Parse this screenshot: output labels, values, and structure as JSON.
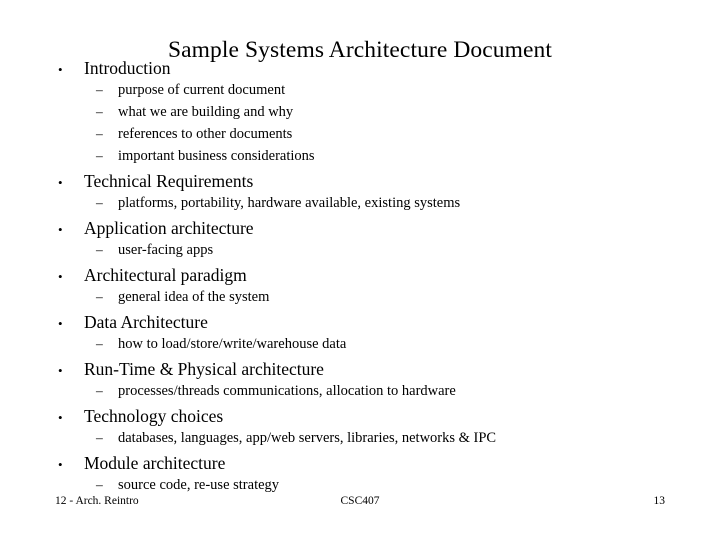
{
  "slide": {
    "title": "Sample Systems Architecture Document",
    "bullet_mark": "•",
    "sub_mark": "–",
    "sections": [
      {
        "heading": "Introduction",
        "items": [
          "purpose of current document",
          "what we are building and why",
          "references to other documents",
          "important business considerations"
        ]
      },
      {
        "heading": "Technical Requirements",
        "items": [
          "platforms, portability, hardware available, existing systems"
        ]
      },
      {
        "heading": "Application architecture",
        "items": [
          "user-facing apps"
        ]
      },
      {
        "heading": "Architectural paradigm",
        "items": [
          "general idea of the system"
        ]
      },
      {
        "heading": "Data Architecture",
        "items": [
          "how to load/store/write/warehouse data"
        ]
      },
      {
        "heading": "Run-Time & Physical architecture",
        "items": [
          "processes/threads communications, allocation to hardware"
        ]
      },
      {
        "heading": "Technology choices",
        "items": [
          "databases, languages, app/web servers, libraries, networks & IPC"
        ]
      },
      {
        "heading": "Module architecture",
        "items": [
          "source code, re-use strategy"
        ]
      }
    ]
  },
  "footer": {
    "left": "12 - Arch. Reintro",
    "center": "CSC407",
    "right": "13"
  }
}
